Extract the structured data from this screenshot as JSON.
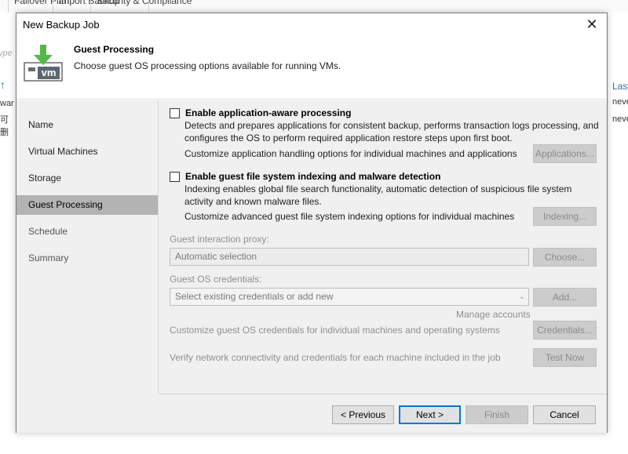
{
  "background": {
    "ribbon_items": [
      "Failover Plan",
      "Import Backup",
      "Security & Compliance"
    ],
    "left_texts": [
      "ype",
      "war",
      "可删"
    ],
    "right_texts": [
      "Last",
      "neve",
      "neve"
    ]
  },
  "dialog": {
    "title": "New Backup Job",
    "close_glyph": "✕"
  },
  "header": {
    "title": "Guest Processing",
    "subtitle": "Choose guest OS processing options available for running VMs.",
    "icon_label": "vm",
    "accent_color": "#54b948"
  },
  "nav": {
    "items": [
      {
        "label": "Name"
      },
      {
        "label": "Virtual Machines"
      },
      {
        "label": "Storage"
      },
      {
        "label": "Guest Processing"
      },
      {
        "label": "Schedule"
      },
      {
        "label": "Summary"
      }
    ],
    "active_index": 3
  },
  "app_aware": {
    "label": "Enable application-aware processing",
    "checked": false,
    "description": "Detects and prepares applications for consistent backup, performs transaction logs processing, and configures the OS to perform required application restore steps upon first boot.",
    "customize_text": "Customize application handling options for individual machines and applications",
    "button": "Applications..."
  },
  "indexing": {
    "label": "Enable guest file system indexing and malware detection",
    "checked": false,
    "description": "Indexing enables global file search functionality, automatic detection of suspicious file system activity and known malware files.",
    "customize_text": "Customize advanced guest file system indexing options for individual machines",
    "button": "Indexing..."
  },
  "proxy": {
    "label": "Guest interaction proxy:",
    "value": "Automatic selection",
    "button": "Choose..."
  },
  "credentials": {
    "label": "Guest OS credentials:",
    "placeholder": "Select existing credentials or add new",
    "add_button": "Add...",
    "manage_link": "Manage accounts",
    "customize_text": "Customize guest OS credentials for individual machines and operating systems",
    "button": "Credentials...",
    "verify_text": "Verify network connectivity and credentials for each machine included in the job",
    "test_button": "Test Now"
  },
  "footer": {
    "previous": "< Previous",
    "next": "Next >",
    "finish": "Finish",
    "cancel": "Cancel"
  }
}
